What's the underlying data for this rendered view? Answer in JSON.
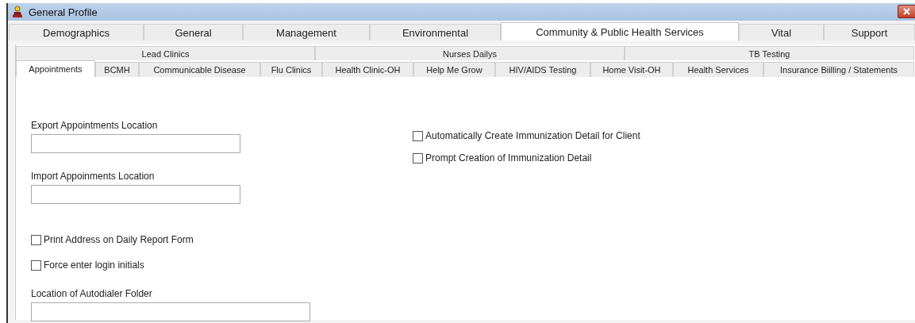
{
  "window": {
    "title": "General Profile"
  },
  "main_tabs": [
    {
      "label": "Demographics",
      "selected": false
    },
    {
      "label": "General",
      "selected": false
    },
    {
      "label": "Management",
      "selected": false
    },
    {
      "label": "Environmental",
      "selected": false
    },
    {
      "label": "Community & Public Health Services",
      "selected": true
    },
    {
      "label": "Vital",
      "selected": false
    },
    {
      "label": "Support",
      "selected": false
    }
  ],
  "section_tabs": [
    {
      "label": "Lead Clinics",
      "selected": false
    },
    {
      "label": "Nurses Dailys",
      "selected": false
    },
    {
      "label": "TB Testing",
      "selected": false
    }
  ],
  "sub_tabs": [
    {
      "label": "Appointments",
      "selected": true
    },
    {
      "label": "BCMH",
      "selected": false
    },
    {
      "label": "Communicable Disease",
      "selected": false
    },
    {
      "label": "Flu Clinics",
      "selected": false
    },
    {
      "label": "Health Clinic-OH",
      "selected": false
    },
    {
      "label": "Help Me Grow",
      "selected": false
    },
    {
      "label": "HIV/AIDS Testing",
      "selected": false
    },
    {
      "label": "Home Visit-OH",
      "selected": false
    },
    {
      "label": "Health Services",
      "selected": false
    },
    {
      "label": "Insurance Biilling / Statements",
      "selected": false
    }
  ],
  "form": {
    "left": [
      {
        "kind": "field",
        "label": "Export Appointments Location"
      },
      {
        "kind": "field",
        "label": "Import Appoinments Location"
      },
      {
        "kind": "checkbox",
        "label": "Print Address on Daily Report Form",
        "checked": false
      },
      {
        "kind": "checkbox",
        "label": "Force enter login initials",
        "checked": false
      },
      {
        "kind": "field",
        "label": "Location of Autodialer Folder"
      }
    ],
    "right": [
      {
        "kind": "checkbox",
        "label": "Automatically Create Immunization Detail for Client",
        "checked": false
      },
      {
        "kind": "checkbox",
        "label": "Prompt Creation of Immunization Detail",
        "checked": false
      }
    ]
  }
}
